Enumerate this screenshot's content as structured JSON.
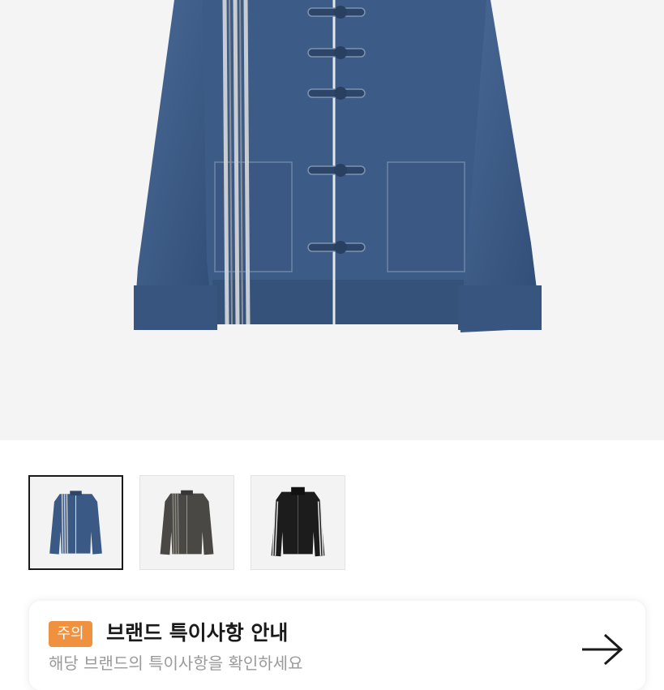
{
  "hero_image": {
    "icon": "denim-jacket-photo"
  },
  "thumbnails": [
    {
      "icon": "denim-jacket-thumbnail",
      "selected": true
    },
    {
      "icon": "charcoal-jacket-thumbnail",
      "selected": false
    },
    {
      "icon": "black-track-jacket-thumbnail",
      "selected": false
    }
  ],
  "notice": {
    "badge": "주의",
    "title": "브랜드 특이사항 안내",
    "subtitle": "해당 브랜드의 특이사항을 확인하세요",
    "arrow_icon": "arrow-right-icon"
  },
  "colors": {
    "badge": "#f0913f",
    "denim": "#3a5a85",
    "charcoal": "#4a4845",
    "black": "#1c1c1c"
  }
}
